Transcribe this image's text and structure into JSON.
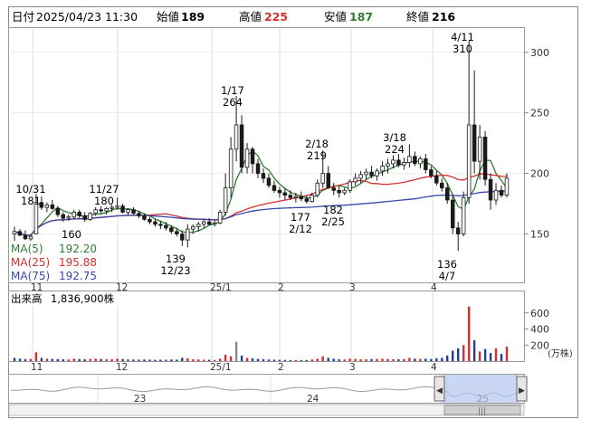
{
  "header": {
    "date_label": "日付",
    "date_value": "2025/04/23 11:30",
    "open_label": "始値",
    "open_value": "189",
    "high_label": "高値",
    "high_value": "225",
    "low_label": "安値",
    "low_value": "187",
    "close_label": "終値",
    "close_value": "216"
  },
  "legend": [
    {
      "label": "MA(5)",
      "value": "192.20",
      "color": "#2e7d32"
    },
    {
      "label": "MA(25)",
      "value": "195.88",
      "color": "#d32f2f"
    },
    {
      "label": "MA(75)",
      "value": "192.75",
      "color": "#3949ab"
    }
  ],
  "volume_panel": {
    "title": "出来高",
    "value": "1,836,900株",
    "unit": "(万株)"
  },
  "chart_data": {
    "type": "candlestick",
    "price_axis": {
      "ticks": [
        "300",
        "250",
        "200",
        "150"
      ],
      "range": [
        110,
        320
      ]
    },
    "volume_axis": {
      "ticks": [
        "600",
        "400",
        "200"
      ],
      "range": [
        0,
        800
      ]
    },
    "x_month_labels": [
      "11",
      "12",
      "25/1",
      "2",
      "3",
      "4"
    ],
    "navigator_year_labels": [
      "23",
      "24",
      "25"
    ],
    "annotations": [
      {
        "date": "10/31",
        "value": "181"
      },
      {
        "date": "",
        "value": "160"
      },
      {
        "date": "11/27",
        "value": "180"
      },
      {
        "date": "1/17",
        "value": "264"
      },
      {
        "date": "12/23",
        "value": "139"
      },
      {
        "date": "2/18",
        "value": "219"
      },
      {
        "date": "2/12",
        "value": "177"
      },
      {
        "date": "2/25",
        "value": "182"
      },
      {
        "date": "3/18",
        "value": "224"
      },
      {
        "date": "4/11",
        "value": "310"
      },
      {
        "date": "4/7",
        "value": "136"
      }
    ],
    "colors": {
      "up": "#1a1a1a",
      "down": "#1a1a1a",
      "vol_up": "#d32f2f",
      "vol_down": "#1f3f99",
      "vol_flat": "#888888"
    },
    "ohlc": [
      [
        150,
        156,
        144,
        152
      ],
      [
        152,
        154,
        148,
        149
      ],
      [
        149,
        153,
        145,
        146
      ],
      [
        146,
        150,
        143,
        148
      ],
      [
        150,
        183,
        150,
        176
      ],
      [
        176,
        181,
        170,
        172
      ],
      [
        172,
        176,
        168,
        174
      ],
      [
        174,
        178,
        170,
        171
      ],
      [
        171,
        173,
        164,
        166
      ],
      [
        166,
        168,
        160,
        163
      ],
      [
        163,
        166,
        161,
        164
      ],
      [
        164,
        170,
        162,
        168
      ],
      [
        168,
        170,
        163,
        165
      ],
      [
        165,
        168,
        160,
        162
      ],
      [
        162,
        168,
        161,
        167
      ],
      [
        167,
        172,
        165,
        170
      ],
      [
        170,
        173,
        167,
        169
      ],
      [
        169,
        172,
        166,
        171
      ],
      [
        171,
        174,
        168,
        172
      ],
      [
        172,
        180,
        170,
        173
      ],
      [
        173,
        175,
        167,
        168
      ],
      [
        168,
        171,
        165,
        170
      ],
      [
        170,
        172,
        166,
        167
      ],
      [
        167,
        169,
        163,
        165
      ],
      [
        165,
        167,
        161,
        162
      ],
      [
        162,
        164,
        158,
        160
      ],
      [
        160,
        162,
        156,
        158
      ],
      [
        158,
        161,
        154,
        157
      ],
      [
        157,
        160,
        153,
        155
      ],
      [
        155,
        157,
        150,
        152
      ],
      [
        152,
        155,
        148,
        150
      ],
      [
        150,
        153,
        140,
        145
      ],
      [
        145,
        158,
        139,
        154
      ],
      [
        154,
        158,
        150,
        156
      ],
      [
        156,
        160,
        152,
        158
      ],
      [
        158,
        162,
        155,
        160
      ],
      [
        160,
        163,
        157,
        158
      ],
      [
        158,
        161,
        156,
        159
      ],
      [
        159,
        170,
        158,
        168
      ],
      [
        168,
        200,
        165,
        188
      ],
      [
        188,
        230,
        180,
        220
      ],
      [
        220,
        264,
        210,
        240
      ],
      [
        240,
        248,
        200,
        205
      ],
      [
        205,
        225,
        200,
        220
      ],
      [
        220,
        222,
        200,
        208
      ],
      [
        208,
        212,
        196,
        200
      ],
      [
        200,
        204,
        192,
        196
      ],
      [
        196,
        200,
        188,
        190
      ],
      [
        190,
        194,
        184,
        186
      ],
      [
        186,
        189,
        180,
        184
      ],
      [
        184,
        188,
        178,
        182
      ],
      [
        182,
        186,
        178,
        180
      ],
      [
        180,
        184,
        176,
        181
      ],
      [
        181,
        185,
        177,
        179
      ],
      [
        179,
        182,
        175,
        177
      ],
      [
        177,
        184,
        176,
        182
      ],
      [
        182,
        195,
        180,
        192
      ],
      [
        192,
        219,
        188,
        200
      ],
      [
        200,
        206,
        190,
        188
      ],
      [
        188,
        192,
        182,
        186
      ],
      [
        186,
        190,
        180,
        184
      ],
      [
        184,
        188,
        182,
        186
      ],
      [
        186,
        195,
        184,
        193
      ],
      [
        193,
        200,
        190,
        196
      ],
      [
        196,
        202,
        192,
        199
      ],
      [
        199,
        204,
        195,
        201
      ],
      [
        201,
        206,
        196,
        198
      ],
      [
        198,
        204,
        194,
        202
      ],
      [
        202,
        210,
        198,
        206
      ],
      [
        206,
        212,
        200,
        208
      ],
      [
        208,
        215,
        204,
        211
      ],
      [
        211,
        216,
        205,
        207
      ],
      [
        207,
        213,
        203,
        209
      ],
      [
        209,
        224,
        205,
        214
      ],
      [
        214,
        218,
        206,
        208
      ],
      [
        208,
        214,
        204,
        212
      ],
      [
        212,
        216,
        200,
        203
      ],
      [
        203,
        206,
        196,
        198
      ],
      [
        198,
        202,
        190,
        192
      ],
      [
        192,
        196,
        185,
        188
      ],
      [
        188,
        192,
        175,
        178
      ],
      [
        178,
        182,
        150,
        155
      ],
      [
        155,
        160,
        136,
        150
      ],
      [
        150,
        185,
        148,
        180
      ],
      [
        180,
        310,
        175,
        240
      ],
      [
        240,
        285,
        200,
        210
      ],
      [
        210,
        240,
        195,
        230
      ],
      [
        230,
        235,
        190,
        195
      ],
      [
        195,
        200,
        170,
        178
      ],
      [
        178,
        192,
        174,
        186
      ],
      [
        186,
        190,
        180,
        182
      ],
      [
        182,
        200,
        180,
        196
      ]
    ],
    "volume": [
      40,
      30,
      25,
      28,
      110,
      40,
      30,
      28,
      26,
      22,
      20,
      30,
      26,
      22,
      28,
      30,
      26,
      24,
      22,
      30,
      26,
      22,
      20,
      18,
      20,
      18,
      16,
      18,
      16,
      20,
      18,
      40,
      35,
      22,
      20,
      18,
      16,
      15,
      30,
      80,
      60,
      240,
      70,
      40,
      35,
      28,
      24,
      20,
      18,
      16,
      15,
      14,
      14,
      14,
      13,
      20,
      30,
      60,
      40,
      30,
      22,
      20,
      30,
      28,
      24,
      22,
      26,
      28,
      30,
      26,
      24,
      22,
      26,
      40,
      30,
      28,
      30,
      26,
      36,
      40,
      70,
      130,
      160,
      200,
      680,
      260,
      120,
      150,
      100,
      160,
      90,
      180
    ],
    "vol_dir": [
      "d",
      "d",
      "d",
      "u",
      "u",
      "d",
      "u",
      "d",
      "d",
      "d",
      "u",
      "u",
      "d",
      "d",
      "u",
      "u",
      "d",
      "u",
      "u",
      "u",
      "d",
      "u",
      "d",
      "d",
      "d",
      "d",
      "d",
      "d",
      "d",
      "d",
      "d",
      "d",
      "u",
      "u",
      "u",
      "u",
      "d",
      "u",
      "u",
      "u",
      "u",
      "n",
      "d",
      "u",
      "d",
      "d",
      "d",
      "d",
      "d",
      "d",
      "d",
      "d",
      "u",
      "d",
      "d",
      "u",
      "u",
      "u",
      "d",
      "d",
      "d",
      "u",
      "u",
      "u",
      "u",
      "u",
      "d",
      "u",
      "u",
      "u",
      "u",
      "d",
      "u",
      "u",
      "d",
      "u",
      "d",
      "d",
      "d",
      "d",
      "d",
      "d",
      "d",
      "u",
      "u",
      "d",
      "u",
      "d",
      "d",
      "u",
      "d",
      "u"
    ]
  }
}
